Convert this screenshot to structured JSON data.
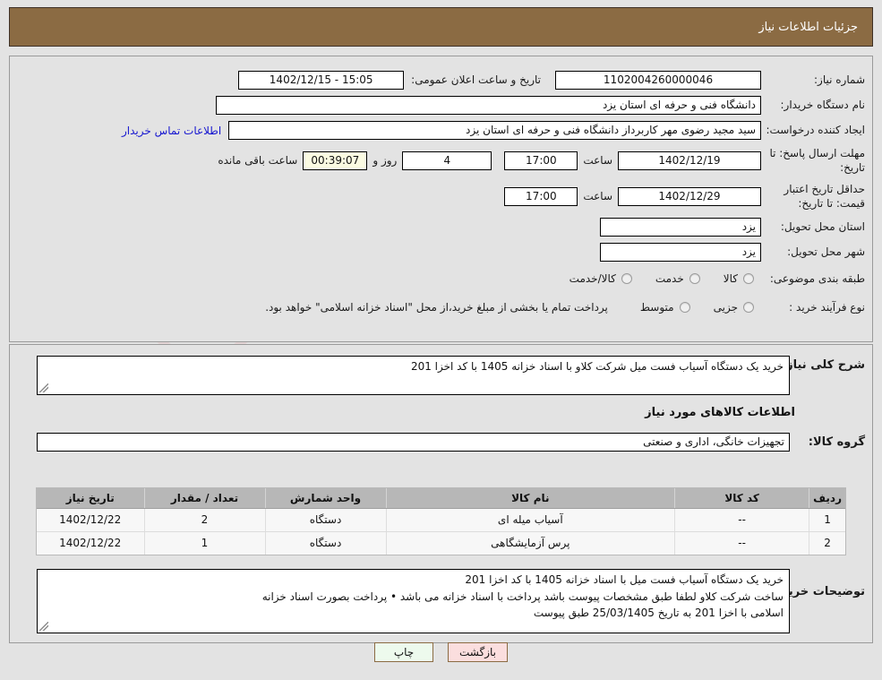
{
  "header": {
    "title": "جزئیات اطلاعات نیاز"
  },
  "form": {
    "need_number_label": "شماره نیاز:",
    "need_number_value": "1102004260000046",
    "announce_label": "تاریخ و ساعت اعلان عمومی:",
    "announce_value": "15:05 - 1402/12/15",
    "buyer_org_label": "نام دستگاه خریدار:",
    "buyer_org_value": "دانشگاه فنی و حرفه ای استان یزد",
    "creator_label": "ایجاد کننده درخواست:",
    "creator_value": "سید مجید رضوی مهر کاربرداز دانشگاه فنی و حرفه ای استان یزد",
    "contact_link": "اطلاعات تماس خریدار",
    "deadline_label": "مهلت ارسال پاسخ: تا تاریخ:",
    "deadline_date": "1402/12/19",
    "hour_label": "ساعت",
    "deadline_time": "17:00",
    "days_value": "4",
    "days_label": "روز و",
    "countdown_value": "00:39:07",
    "countdown_label": "ساعت باقی مانده",
    "validity_label": "حداقل تاریخ اعتبار قیمت: تا تاریخ:",
    "validity_date": "1402/12/29",
    "validity_time": "17:00",
    "province_label": "استان محل تحویل:",
    "province_value": "یزد",
    "city_label": "شهر محل تحویل:",
    "city_value": "یزد",
    "category_label": "طبقه بندی موضوعی:",
    "category_options": [
      "کالا",
      "خدمت",
      "کالا/خدمت"
    ],
    "process_label": "نوع فرآیند خرید :",
    "process_options": [
      "جزیی",
      "متوسط"
    ],
    "process_note": "پرداخت تمام یا بخشی از مبلغ خرید،از محل \"اسناد خزانه اسلامی\" خواهد بود."
  },
  "summary": {
    "label": "شرح کلی نیاز:",
    "value": "خرید یک دستگاه آسیاب فست میل شرکت کلاو با اسناد خزانه 1405 با کد اخزا 201"
  },
  "goods": {
    "section_title": "اطلاعات کالاهای مورد نیاز",
    "group_label": "گروه کالا:",
    "group_value": "تجهیزات خانگی، اداری و صنعتی",
    "columns": [
      "ردیف",
      "کد کالا",
      "نام کالا",
      "واحد شمارش",
      "تعداد / مقدار",
      "تاریخ نیاز"
    ],
    "rows": [
      {
        "row": "1",
        "code": "--",
        "name": "آسیاب میله ای",
        "unit": "دستگاه",
        "qty": "2",
        "date": "1402/12/22"
      },
      {
        "row": "2",
        "code": "--",
        "name": "پرس آزمایشگاهی",
        "unit": "دستگاه",
        "qty": "1",
        "date": "1402/12/22"
      }
    ]
  },
  "notes": {
    "label": "توضیحات خریدار:",
    "line1": "خرید یک دستگاه آسیاب فست میل با اسناد خزانه 1405 با کد اخزا 201",
    "line2": "ساخت شرکت کلاو لطفا طبق مشخصات پیوست باشد پرداخت با اسناد خزانه می باشد • پرداخت  بصورت اسناد خزانه",
    "line3": "اسلامی با اخزا 201 به تاریخ  25/03/1405 طبق پیوست"
  },
  "footer": {
    "print_label": "چاپ",
    "back_label": "بازگشت"
  },
  "watermark": {
    "text": "AriaTender",
    "suffix": ".net"
  }
}
